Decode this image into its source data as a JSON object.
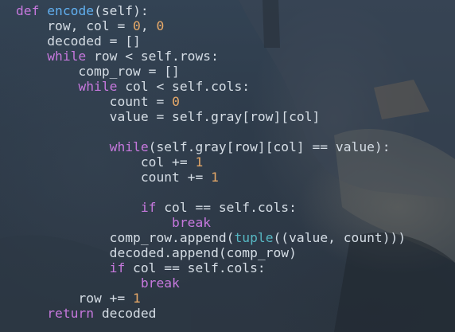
{
  "editor": {
    "lines": [
      {
        "i": 0,
        "t": [
          {
            "k": "kw",
            "s": "def"
          },
          {
            "k": "txt",
            "s": " "
          },
          {
            "k": "fn",
            "s": "encode"
          },
          {
            "k": "txt",
            "s": "(self):"
          }
        ]
      },
      {
        "i": 1,
        "t": [
          {
            "k": "txt",
            "s": "row, col = "
          },
          {
            "k": "num",
            "s": "0"
          },
          {
            "k": "txt",
            "s": ", "
          },
          {
            "k": "num",
            "s": "0"
          }
        ]
      },
      {
        "i": 1,
        "t": [
          {
            "k": "txt",
            "s": "decoded = []"
          }
        ]
      },
      {
        "i": 1,
        "t": [
          {
            "k": "kw",
            "s": "while"
          },
          {
            "k": "txt",
            "s": " row < self.rows:"
          }
        ]
      },
      {
        "i": 2,
        "t": [
          {
            "k": "txt",
            "s": "comp_row = []"
          }
        ]
      },
      {
        "i": 2,
        "t": [
          {
            "k": "kw",
            "s": "while"
          },
          {
            "k": "txt",
            "s": " col < self.cols:"
          }
        ]
      },
      {
        "i": 3,
        "t": [
          {
            "k": "txt",
            "s": "count = "
          },
          {
            "k": "num",
            "s": "0"
          }
        ]
      },
      {
        "i": 3,
        "t": [
          {
            "k": "txt",
            "s": "value = self.gray[row][col]"
          }
        ]
      },
      {
        "i": 0,
        "t": []
      },
      {
        "i": 3,
        "t": [
          {
            "k": "kw",
            "s": "while"
          },
          {
            "k": "txt",
            "s": "(self.gray[row][col] == value):"
          }
        ]
      },
      {
        "i": 4,
        "t": [
          {
            "k": "txt",
            "s": "col += "
          },
          {
            "k": "num",
            "s": "1"
          }
        ]
      },
      {
        "i": 4,
        "t": [
          {
            "k": "txt",
            "s": "count += "
          },
          {
            "k": "num",
            "s": "1"
          }
        ]
      },
      {
        "i": 0,
        "t": []
      },
      {
        "i": 4,
        "t": [
          {
            "k": "kw",
            "s": "if"
          },
          {
            "k": "txt",
            "s": " col == self.cols:"
          }
        ]
      },
      {
        "i": 5,
        "t": [
          {
            "k": "kw",
            "s": "break"
          }
        ]
      },
      {
        "i": 3,
        "t": [
          {
            "k": "txt",
            "s": "comp_row.append("
          },
          {
            "k": "bi",
            "s": "tuple"
          },
          {
            "k": "txt",
            "s": "((value, count)))"
          }
        ]
      },
      {
        "i": 3,
        "t": [
          {
            "k": "txt",
            "s": "decoded.append(comp_row)"
          }
        ]
      },
      {
        "i": 3,
        "t": [
          {
            "k": "kw",
            "s": "if"
          },
          {
            "k": "txt",
            "s": " col == self.cols:"
          }
        ]
      },
      {
        "i": 4,
        "t": [
          {
            "k": "kw",
            "s": "break"
          }
        ]
      },
      {
        "i": 2,
        "t": [
          {
            "k": "txt",
            "s": "row += "
          },
          {
            "k": "num",
            "s": "1"
          }
        ]
      },
      {
        "i": 1,
        "t": [
          {
            "k": "kw",
            "s": "return"
          },
          {
            "k": "txt",
            "s": " decoded"
          }
        ]
      }
    ]
  },
  "colors": {
    "keyword": "#c678dd",
    "function": "#61afef",
    "builtin": "#56b6c2",
    "number": "#e5a868",
    "text": "#d5dde5"
  }
}
